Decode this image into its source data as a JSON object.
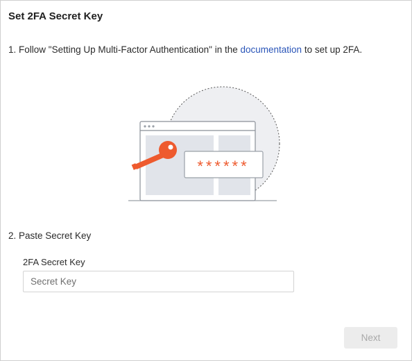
{
  "dialog": {
    "title": "Set 2FA Secret Key",
    "step1": {
      "prefix": "1. Follow \"Setting Up Multi-Factor Authentication\" in the ",
      "link": "documentation",
      "suffix": " to set up 2FA."
    },
    "illustration": {
      "password_mask": "******",
      "accent_color": "#ee5a2e"
    },
    "step2": "2. Paste Secret Key",
    "field": {
      "label": "2FA Secret Key",
      "value": "",
      "placeholder": "Secret Key"
    },
    "next_button": "Next"
  }
}
